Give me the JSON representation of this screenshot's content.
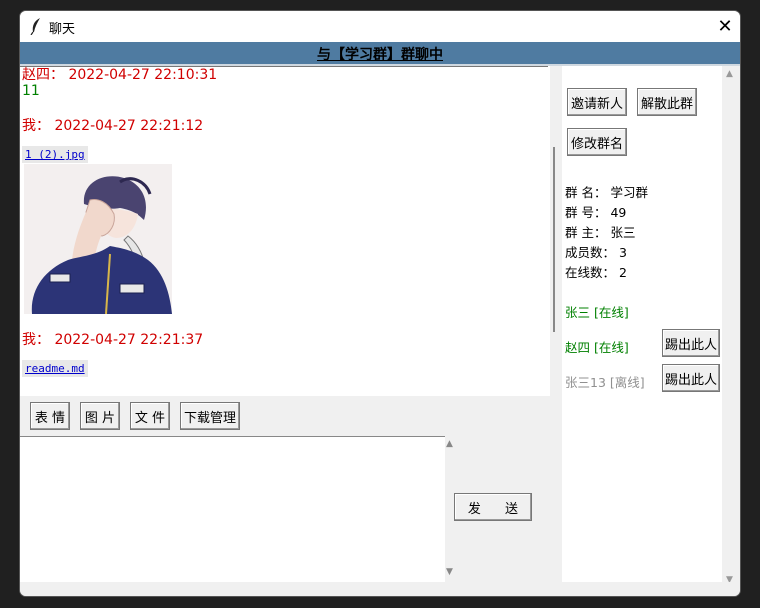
{
  "window": {
    "title": "聊天",
    "close_label": "✕"
  },
  "banner": {
    "text": "与【学习群】群聊中"
  },
  "messages": [
    {
      "sender_time": "赵四： 2022-04-27 22:10:31",
      "text": "11"
    },
    {
      "sender_time": "我： 2022-04-27 22:21:12",
      "file": "1 (2).jpg",
      "has_image": true
    },
    {
      "sender_time": "我： 2022-04-27 22:21:37",
      "file": "readme.md"
    }
  ],
  "toolbar": {
    "emoji_label": "表 情",
    "image_label": "图 片",
    "file_label": "文 件",
    "download_label": "下载管理"
  },
  "composer": {
    "send_label": "发 送"
  },
  "side": {
    "invite_label": "邀请新人",
    "dissolve_label": "解散此群",
    "rename_label": "修改群名",
    "info": {
      "name": "群  名： 学习群",
      "id": "群  号： 49",
      "owner": "群  主： 张三",
      "members": "成员数： 3",
      "online": "在线数： 2"
    },
    "member_list": [
      {
        "label": "张三 [在线]",
        "status": "online"
      },
      {
        "label": "赵四 [在线]",
        "status": "online",
        "kick_label": "踢出此人"
      },
      {
        "label": "张三13 [离线]",
        "status": "offline",
        "kick_label": "踢出此人"
      }
    ]
  },
  "colors": {
    "banner": "#4f7ba1",
    "sender": "#d00000",
    "message": "#008000",
    "offline": "#909090"
  }
}
